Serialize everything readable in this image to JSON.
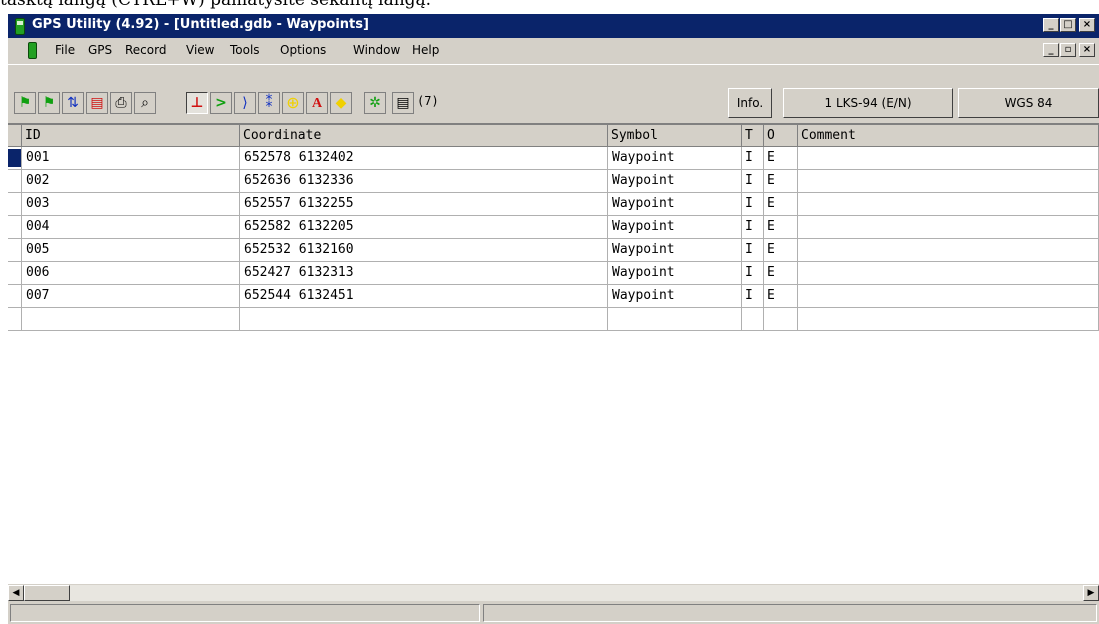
{
  "doc_fragment": "tasktą langą (CTRL+W) pamatysite sekantį langą.",
  "window": {
    "title": "GPS Utility (4.92) - [Untitled.gdb - Waypoints]",
    "caption_buttons": [
      "_",
      "□",
      "×"
    ],
    "doc_buttons": [
      "_",
      "▫",
      "×"
    ]
  },
  "menu": [
    "File",
    "GPS",
    "Record",
    "View",
    "Tools",
    "Options",
    "Window",
    "Help"
  ],
  "toolbar": {
    "icons": [
      "waypoint-new-icon",
      "waypoint-edit-icon",
      "transfer-icon",
      "record-icon",
      "print-icon",
      "search-icon",
      "waypoint-mode-icon",
      "route-mode-icon",
      "track-mode-icon",
      "trackpoint-mode-icon",
      "target-mode-icon",
      "text-mode-icon",
      "area-mode-icon",
      "colour-icon",
      "list-icon"
    ],
    "count": "(7)",
    "info_label": "Info.",
    "grid_label": "1 LKS-94 (E/N)",
    "datum_label": "WGS 84",
    "colors": {
      "red": "#d01010",
      "green": "#10a010",
      "blue": "#1030c0",
      "yellow": "#f0d000"
    }
  },
  "table": {
    "headers": [
      "ID",
      "Coordinate",
      "Symbol",
      "T",
      "O",
      "Comment"
    ],
    "rows": [
      {
        "id": "001",
        "coord": "652578 6132402",
        "symbol": "Waypoint",
        "t": "I",
        "o": "E",
        "comment": ""
      },
      {
        "id": "002",
        "coord": "652636 6132336",
        "symbol": "Waypoint",
        "t": "I",
        "o": "E",
        "comment": ""
      },
      {
        "id": "003",
        "coord": "652557 6132255",
        "symbol": "Waypoint",
        "t": "I",
        "o": "E",
        "comment": ""
      },
      {
        "id": "004",
        "coord": "652582 6132205",
        "symbol": "Waypoint",
        "t": "I",
        "o": "E",
        "comment": ""
      },
      {
        "id": "005",
        "coord": "652532 6132160",
        "symbol": "Waypoint",
        "t": "I",
        "o": "E",
        "comment": ""
      },
      {
        "id": "006",
        "coord": "652427 6132313",
        "symbol": "Waypoint",
        "t": "I",
        "o": "E",
        "comment": ""
      },
      {
        "id": "007",
        "coord": "652544 6132451",
        "symbol": "Waypoint",
        "t": "I",
        "o": "E",
        "comment": ""
      }
    ],
    "selected_row_color": "#0a246a"
  },
  "status": {
    "left": "",
    "right": ""
  }
}
